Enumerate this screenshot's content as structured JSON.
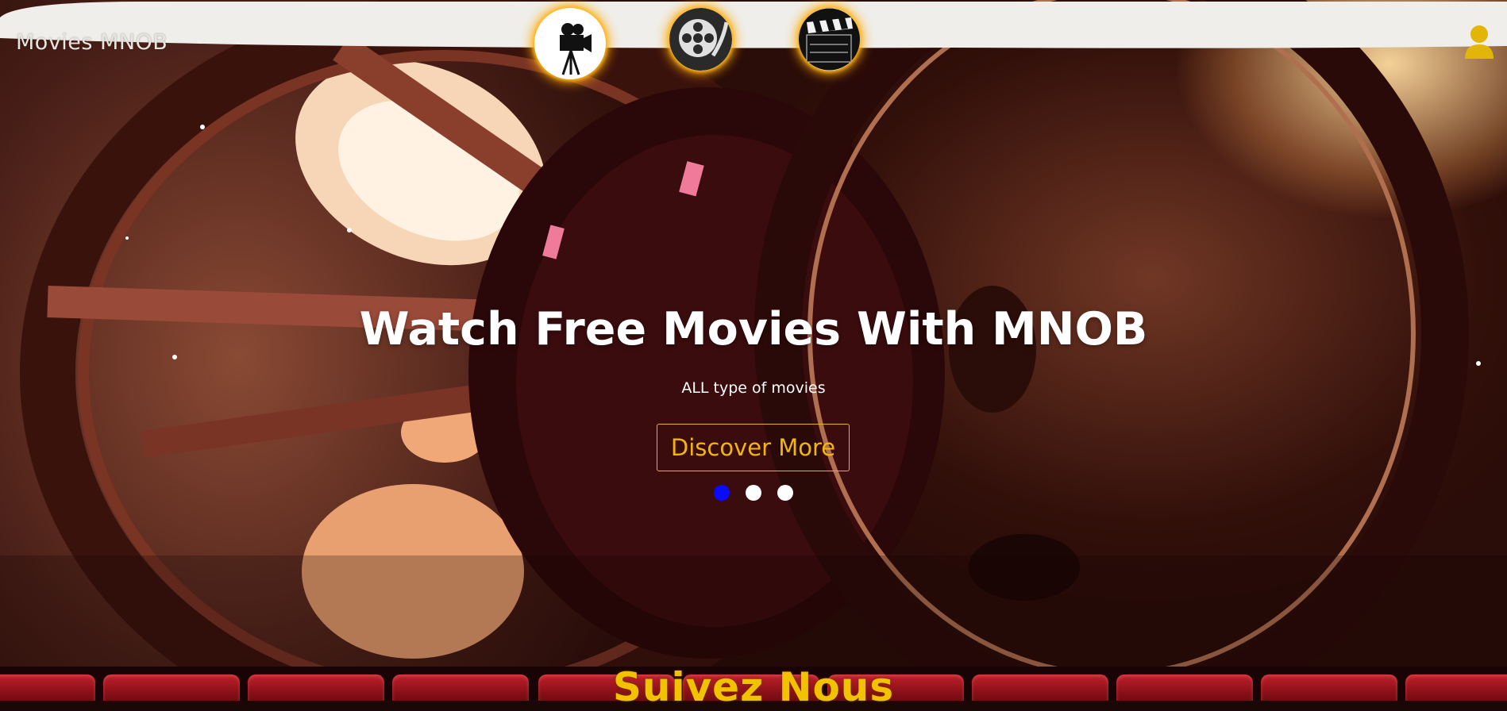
{
  "header": {
    "brand": "Movies MNOB",
    "nav_icons": [
      "movie-camera-icon",
      "film-reel-icon",
      "clapperboard-icon"
    ],
    "user_icon": "user-icon"
  },
  "hero": {
    "title": "Watch Free Movies With MNOB",
    "subtitle": "ALL type of movies",
    "cta_label": "Discover More",
    "slides": 3,
    "active_slide": 1
  },
  "footer": {
    "title": "Suivez Nous"
  },
  "colors": {
    "accent": "#f0b60e",
    "active_dot": "#0a0aff",
    "header_bg": "#efeeea",
    "glow": "#ffaa00"
  }
}
